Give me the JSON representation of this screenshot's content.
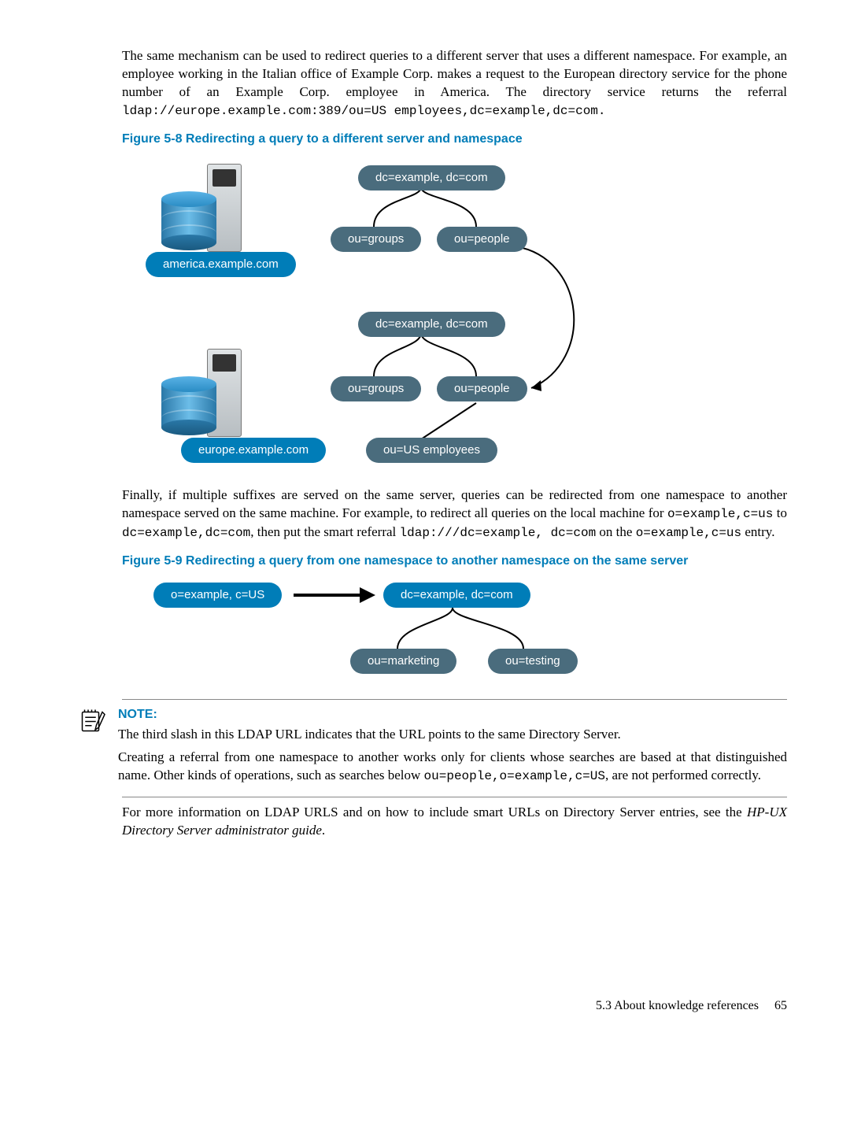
{
  "para1": "The same mechanism can be used to redirect queries to a different server that uses a different namespace. For example, an employee working in the Italian office of Example Corp. makes a request to the European directory service for the phone number of an Example Corp. employee in America. The directory service returns the referral",
  "ldap1": "ldap://europe.example.com:389/ou=US employees,dc=example,dc=com.",
  "fig1": {
    "caption": "Figure 5-8 Redirecting a query to a different server and namespace",
    "node_top": "dc=example, dc=com",
    "node_groups": "ou=groups",
    "node_people": "ou=people",
    "server1": "america.example.com",
    "node_top2": "dc=example, dc=com",
    "node_groups2": "ou=groups",
    "node_people2": "ou=people",
    "node_usemp": "ou=US employees",
    "server2": "europe.example.com"
  },
  "para2_a": "Finally, if multiple suffixes are served on the same server, queries can be redirected from one namespace to another namespace served on the same machine. For example, to redirect all queries on the local machine for ",
  "para2_code1": "o=example,c=us",
  "para2_b": " to ",
  "para2_code2": "dc=example,dc=com",
  "para2_c": ", then put the smart referral ",
  "para2_code3": "ldap:///dc=example, dc=com",
  "para2_d": " on the ",
  "para2_code4": "o=example,c=us",
  "para2_e": " entry.",
  "fig2": {
    "caption": "Figure 5-9 Redirecting a query from one namespace to another namespace on the same server",
    "left": "o=example, c=US",
    "right": "dc=example, dc=com",
    "child1": "ou=marketing",
    "child2": "ou=testing"
  },
  "note": {
    "title": "NOTE:",
    "p1": "The third slash in this LDAP URL indicates that the URL points to the same Directory Server.",
    "p2a": "Creating a referral from one namespace to another works only for clients whose searches are based at that distinguished name. Other kinds of operations, such as searches below ",
    "p2code": "ou=people,o=example,c=US",
    "p2b": ", are not performed correctly."
  },
  "closing_a": "For more information on LDAP URLS and on how to include smart URLs on Directory Server entries, see the ",
  "closing_ital": "HP-UX Directory Server administrator guide",
  "closing_b": ".",
  "footer_section": "5.3 About knowledge references",
  "footer_page": "65"
}
